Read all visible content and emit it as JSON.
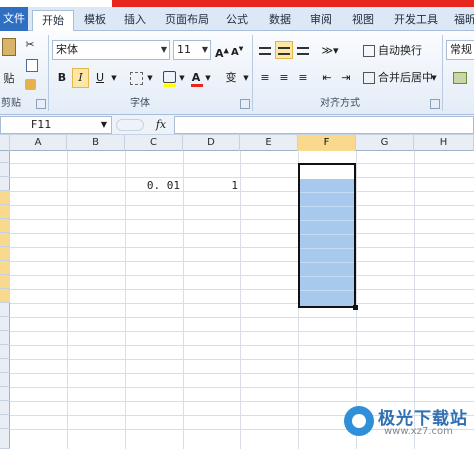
{
  "tabs": [
    "文件",
    "开始",
    "模板",
    "插入",
    "页面布局",
    "公式",
    "数据",
    "审阅",
    "视图",
    "开发工具",
    "福昕"
  ],
  "ribbon": {
    "clipboard_paste_label": "贴",
    "clipboard_group": "剪贴板",
    "font_name": "宋体",
    "font_size": "11",
    "bold": "B",
    "italic": "I",
    "underline": "U",
    "font_color_letter": "A",
    "font_group": "字体",
    "wen_label": "变",
    "wrap_text": "自动换行",
    "merge_center": "合并后居中",
    "alignment_group": "对齐方式",
    "number_format": "常规"
  },
  "formula_bar": {
    "name_box": "F11",
    "fx": "fx"
  },
  "columns": [
    "A",
    "B",
    "C",
    "D",
    "E",
    "F",
    "G",
    "H"
  ],
  "cells": {
    "C3": "0. 01",
    "D3": "1"
  },
  "colors": {
    "accent": "#2f6fc1",
    "selection_fill": "#a7c9ee",
    "header_highlight": "#f9d98d"
  },
  "watermark": {
    "name": "极光下载站",
    "url": "www.xz7.com"
  }
}
